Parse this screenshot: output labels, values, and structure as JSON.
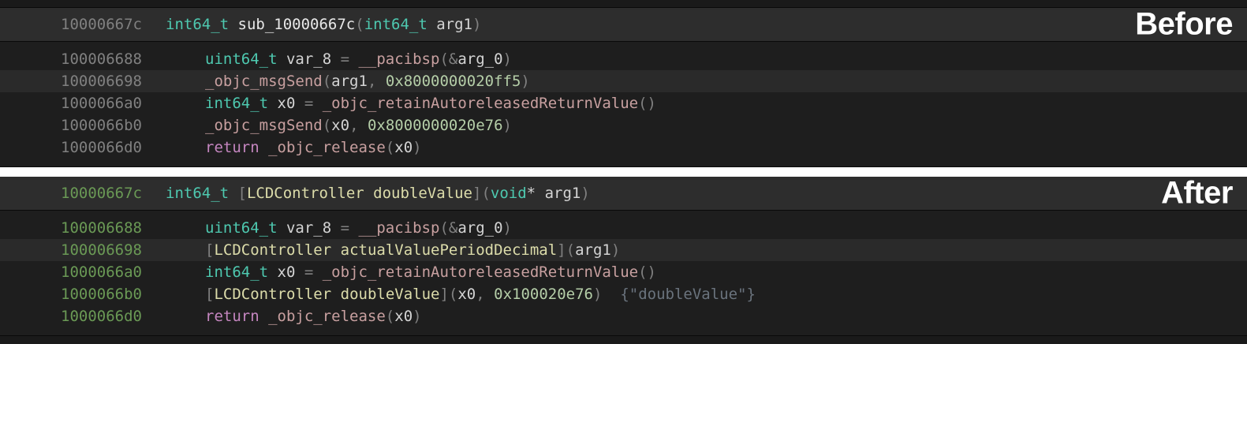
{
  "before": {
    "badge": "Before",
    "header": {
      "addr": "10000667c",
      "ret_type": "int64_t",
      "name": "sub_10000667c",
      "arg_type": "int64_t",
      "arg_name": "arg1"
    },
    "lines": [
      {
        "addr": "100006688",
        "tokens": [
          {
            "cls": "t-type",
            "txt": "uint64_t"
          },
          {
            "cls": "t-ident",
            "txt": " var_8 "
          },
          {
            "cls": "t-punc",
            "txt": "= "
          },
          {
            "cls": "t-call",
            "txt": "__pacibsp"
          },
          {
            "cls": "t-punc",
            "txt": "(&"
          },
          {
            "cls": "t-ident",
            "txt": "arg_0"
          },
          {
            "cls": "t-punc",
            "txt": ")"
          }
        ]
      },
      {
        "addr": "100006698",
        "hl": true,
        "tokens": [
          {
            "cls": "t-call",
            "txt": "_objc_msgSend"
          },
          {
            "cls": "t-punc",
            "txt": "("
          },
          {
            "cls": "t-ident",
            "txt": "arg1"
          },
          {
            "cls": "t-punc",
            "txt": ", "
          },
          {
            "cls": "t-num",
            "txt": "0x8000000020ff5"
          },
          {
            "cls": "t-punc",
            "txt": ")"
          }
        ]
      },
      {
        "addr": "1000066a0",
        "tokens": [
          {
            "cls": "t-type",
            "txt": "int64_t"
          },
          {
            "cls": "t-ident",
            "txt": " x0 "
          },
          {
            "cls": "t-punc",
            "txt": "= "
          },
          {
            "cls": "t-call",
            "txt": "_objc_retainAutoreleasedReturnValue"
          },
          {
            "cls": "t-punc",
            "txt": "()"
          }
        ]
      },
      {
        "addr": "1000066b0",
        "tokens": [
          {
            "cls": "t-call",
            "txt": "_objc_msgSend"
          },
          {
            "cls": "t-punc",
            "txt": "("
          },
          {
            "cls": "t-ident",
            "txt": "x0"
          },
          {
            "cls": "t-punc",
            "txt": ", "
          },
          {
            "cls": "t-num",
            "txt": "0x8000000020e76"
          },
          {
            "cls": "t-punc",
            "txt": ")"
          }
        ]
      },
      {
        "addr": "1000066d0",
        "tokens": [
          {
            "cls": "t-kw",
            "txt": "return "
          },
          {
            "cls": "t-call",
            "txt": "_objc_release"
          },
          {
            "cls": "t-punc",
            "txt": "("
          },
          {
            "cls": "t-ident",
            "txt": "x0"
          },
          {
            "cls": "t-punc",
            "txt": ")"
          }
        ]
      }
    ]
  },
  "after": {
    "badge": "After",
    "header": {
      "addr": "10000667c",
      "ret_type": "int64_t",
      "objc_class": "LCDController",
      "objc_method": "doubleValue",
      "arg_type": "void",
      "arg_ptr": "*",
      "arg_name": "arg1"
    },
    "lines": [
      {
        "addr": "100006688",
        "tokens": [
          {
            "cls": "t-type",
            "txt": "uint64_t"
          },
          {
            "cls": "t-ident",
            "txt": " var_8 "
          },
          {
            "cls": "t-punc",
            "txt": "= "
          },
          {
            "cls": "t-call",
            "txt": "__pacibsp"
          },
          {
            "cls": "t-punc",
            "txt": "(&"
          },
          {
            "cls": "t-ident",
            "txt": "arg_0"
          },
          {
            "cls": "t-punc",
            "txt": ")"
          }
        ]
      },
      {
        "addr": "100006698",
        "hl": true,
        "tokens": [
          {
            "cls": "t-punc",
            "txt": "["
          },
          {
            "cls": "t-objc",
            "txt": "LCDController"
          },
          {
            "cls": "t-ident",
            "txt": " "
          },
          {
            "cls": "t-objc",
            "txt": "actualValuePeriodDecimal"
          },
          {
            "cls": "t-punc",
            "txt": "]("
          },
          {
            "cls": "t-ident",
            "txt": "arg1"
          },
          {
            "cls": "t-punc",
            "txt": ")"
          }
        ]
      },
      {
        "addr": "1000066a0",
        "tokens": [
          {
            "cls": "t-type",
            "txt": "int64_t"
          },
          {
            "cls": "t-ident",
            "txt": " x0 "
          },
          {
            "cls": "t-punc",
            "txt": "= "
          },
          {
            "cls": "t-call",
            "txt": "_objc_retainAutoreleasedReturnValue"
          },
          {
            "cls": "t-punc",
            "txt": "()"
          }
        ]
      },
      {
        "addr": "1000066b0",
        "tokens": [
          {
            "cls": "t-punc",
            "txt": "["
          },
          {
            "cls": "t-objc",
            "txt": "LCDController"
          },
          {
            "cls": "t-ident",
            "txt": " "
          },
          {
            "cls": "t-objc",
            "txt": "doubleValue"
          },
          {
            "cls": "t-punc",
            "txt": "]("
          },
          {
            "cls": "t-ident",
            "txt": "x0"
          },
          {
            "cls": "t-punc",
            "txt": ", "
          },
          {
            "cls": "t-num",
            "txt": "0x100020e76"
          },
          {
            "cls": "t-punc",
            "txt": ")  "
          },
          {
            "cls": "t-comment",
            "txt": "{\"doubleValue\"}"
          }
        ]
      },
      {
        "addr": "1000066d0",
        "tokens": [
          {
            "cls": "t-kw",
            "txt": "return "
          },
          {
            "cls": "t-call",
            "txt": "_objc_release"
          },
          {
            "cls": "t-punc",
            "txt": "("
          },
          {
            "cls": "t-ident",
            "txt": "x0"
          },
          {
            "cls": "t-punc",
            "txt": ")"
          }
        ]
      }
    ]
  }
}
